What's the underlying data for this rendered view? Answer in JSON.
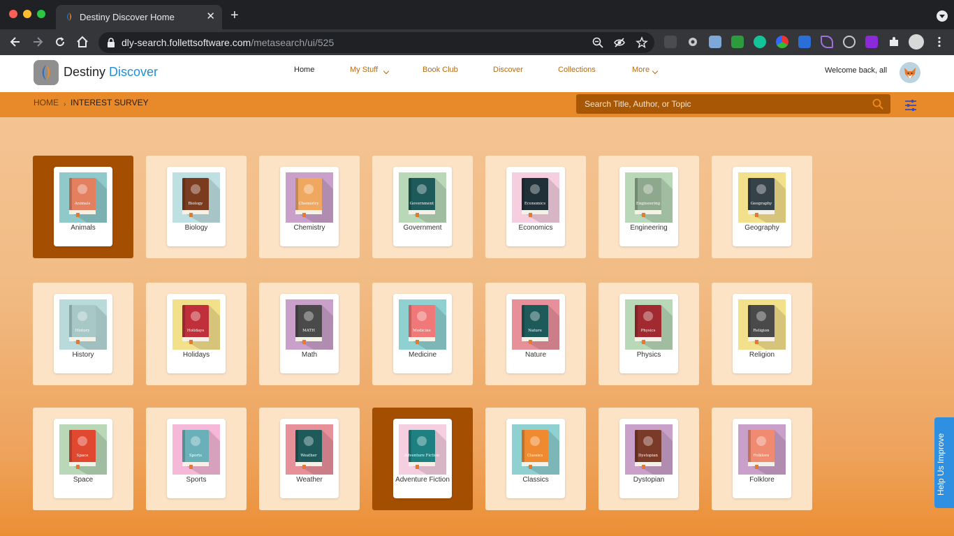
{
  "browser": {
    "tab_title": "Destiny Discover Home",
    "url_domain": "dly-search.follettsoftware.com",
    "url_path": "/metasearch/ui/525",
    "new_tab_label": "+",
    "tab_close_label": "✕"
  },
  "header": {
    "brand_destiny": "Destiny",
    "brand_discover": "Discover",
    "nav": [
      {
        "label": "Home"
      },
      {
        "label": "My Stuff"
      },
      {
        "label": "Book Club"
      },
      {
        "label": "Discover"
      },
      {
        "label": "Collections"
      },
      {
        "label": "More"
      }
    ],
    "welcome": "Welcome back, all"
  },
  "breadcrumb": {
    "home": "HOME",
    "separator": "›",
    "current": "INTEREST SURVEY"
  },
  "search": {
    "placeholder": "Search Title, Author, or Topic"
  },
  "topics": [
    {
      "label": "Animals",
      "cover_text": "Animals",
      "bg": "#8fc9c9",
      "book": "#e48060",
      "selected": true
    },
    {
      "label": "Biology",
      "cover_text": "Biology",
      "bg": "#bfe0e2",
      "book": "#7a3b1e",
      "selected": false
    },
    {
      "label": "Chemistry",
      "cover_text": "Chemistry",
      "bg": "#c9a0c9",
      "book": "#f0a860",
      "selected": false
    },
    {
      "label": "Government",
      "cover_text": "Government",
      "bg": "#b8d8b8",
      "book": "#1e5a5a",
      "selected": false
    },
    {
      "label": "Economics",
      "cover_text": "Economics",
      "bg": "#f5cfe0",
      "book": "#203038",
      "selected": false
    },
    {
      "label": "Engineering",
      "cover_text": "Engineering",
      "bg": "#b8d8b8",
      "book": "#8ea88e",
      "selected": false
    },
    {
      "label": "Geography",
      "cover_text": "Geography",
      "bg": "#f3e08a",
      "book": "#36424a",
      "selected": false
    },
    {
      "label": "History",
      "cover_text": "History",
      "bg": "#b8dada",
      "book": "#a8c8c8",
      "selected": false
    },
    {
      "label": "Holidays",
      "cover_text": "Holidays",
      "bg": "#f3e08a",
      "book": "#c0303a",
      "selected": false
    },
    {
      "label": "Math",
      "cover_text": "MATH",
      "bg": "#c9a0c9",
      "book": "#4a4a4a",
      "selected": false
    },
    {
      "label": "Medicine",
      "cover_text": "Medicine",
      "bg": "#8fd0d0",
      "book": "#f07878",
      "selected": false
    },
    {
      "label": "Nature",
      "cover_text": "Nature",
      "bg": "#e8909a",
      "book": "#1e5a5a",
      "selected": false
    },
    {
      "label": "Physics",
      "cover_text": "Physics",
      "bg": "#b8d8b8",
      "book": "#a02a30",
      "selected": false
    },
    {
      "label": "Religion",
      "cover_text": "Religion",
      "bg": "#f3e08a",
      "book": "#4a4a4a",
      "selected": false
    },
    {
      "label": "Space",
      "cover_text": "Space",
      "bg": "#b8d8b8",
      "book": "#e04830",
      "selected": false
    },
    {
      "label": "Sports",
      "cover_text": "Sports",
      "bg": "#f5b8d8",
      "book": "#6ab0b8",
      "selected": false
    },
    {
      "label": "Weather",
      "cover_text": "Weather",
      "bg": "#e8909a",
      "book": "#1e5a5a",
      "selected": false
    },
    {
      "label": "Adventure Fiction",
      "cover_text": "Adventure Fiction",
      "bg": "#f5cfe0",
      "book": "#1e8080",
      "selected": true
    },
    {
      "label": "Classics",
      "cover_text": "Classics",
      "bg": "#8fd0d0",
      "book": "#f08a30",
      "selected": false
    },
    {
      "label": "Dystopian",
      "cover_text": "Dystopian",
      "bg": "#c9a0c9",
      "book": "#7a3a28",
      "selected": false
    },
    {
      "label": "Folklore",
      "cover_text": "Folklore",
      "bg": "#c9a0c9",
      "book": "#f08a70",
      "selected": false
    }
  ],
  "help": {
    "label": "Help Us Improve"
  },
  "colors": {
    "accent_orange": "#e88a2a",
    "selected_tile": "#a44e02",
    "tile": "#fde3c6",
    "link": "#b86a12",
    "brand_blue": "#1f8fd6",
    "help_blue": "#2f8fe0"
  }
}
